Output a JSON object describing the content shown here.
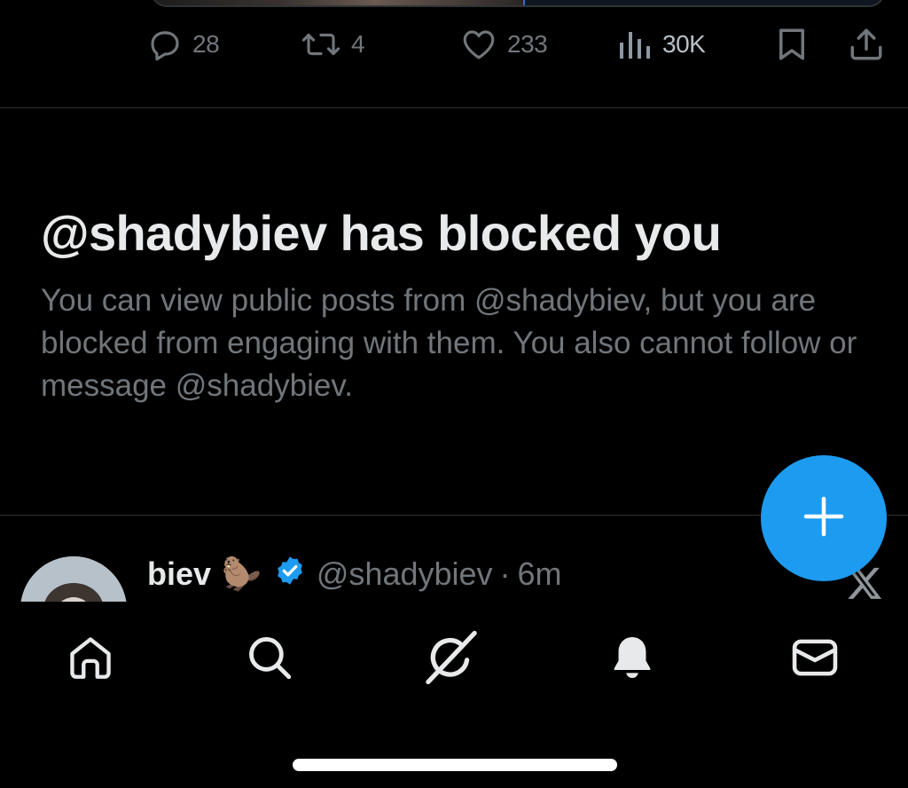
{
  "actions": {
    "reply_count": "28",
    "repost_count": "4",
    "like_count": "233",
    "views_count": "30K"
  },
  "blocked": {
    "title": "@shadybiev has blocked you",
    "message": "You can view public posts from @shadybiev, but you are blocked from engaging with them. You also cannot follow or message @shadybiev."
  },
  "post": {
    "author_name": "biev",
    "author_emoji": "🦫",
    "author_handle": "@shadybiev",
    "separator": "·",
    "time_ago": "6m"
  },
  "icons": {
    "reply": "reply-icon",
    "repost": "repost-icon",
    "like": "heart-icon",
    "views": "views-icon",
    "bookmark": "bookmark-icon",
    "share": "share-icon",
    "compose": "plus-icon",
    "verified": "verified-badge-icon",
    "x_logo": "x-logo-icon",
    "home": "home-icon",
    "search": "search-icon",
    "grok": "grok-icon",
    "notifications": "bell-icon",
    "messages": "envelope-icon"
  },
  "colors": {
    "background": "#000000",
    "accent": "#1d9bf0",
    "text_primary": "#e7e9ea",
    "text_secondary": "#71767b",
    "divider": "#2f3336"
  }
}
